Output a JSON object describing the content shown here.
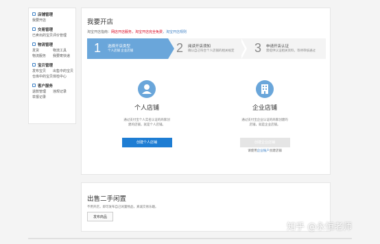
{
  "sidebar": {
    "groups": [
      {
        "title": "店铺管理",
        "rows": [
          [
            "我要开店",
            ""
          ]
        ]
      },
      {
        "title": "交易管理",
        "rows": [
          [
            "已卖出的宝贝",
            "评价管理"
          ]
        ]
      },
      {
        "title": "物流管理",
        "rows": [
          [
            "发货",
            "物流工具"
          ],
          [
            "物流服务",
            "我要寄快递"
          ]
        ]
      },
      {
        "title": "宝贝管理",
        "rows": [
          [
            "发布宝贝",
            "出售中的宝贝"
          ],
          [
            "仓库中的宝贝",
            "体检中心"
          ]
        ]
      },
      {
        "title": "客户服务",
        "rows": [
          [
            "退款管理",
            "违规记录"
          ],
          [
            "举报记录",
            ""
          ]
        ]
      }
    ]
  },
  "main": {
    "title": "我要开店",
    "tip_prefix": "淘宝开店指南：",
    "tip_red": "网店开店服务，淘宝开店完全免费",
    "tip_blue": "，淘宝开店规则",
    "steps": [
      {
        "num": "1",
        "title": "选择开店类型",
        "desc": "个人店铺 企业店铺"
      },
      {
        "num": "2",
        "title": "阅读开店须知",
        "desc": "确认自己符合个人店铺的相关规定"
      },
      {
        "num": "3",
        "title": "申请开店认证",
        "desc": "需提供认证相关资料，等待审核通过"
      }
    ],
    "personal": {
      "name": "个人店铺",
      "desc1": "通过支付宝个人实名认证的商家创",
      "desc2": "建的店铺，就是个人店铺。",
      "button": "创建个人店铺"
    },
    "enterprise": {
      "name": "企业店铺",
      "desc1": "通过支付宝企业认证的商家创建的",
      "desc2": "店铺，就是企业店铺。",
      "button": "创建企业店铺",
      "link_prefix": "请使用",
      "link": "企业账户",
      "link_suffix": "创建店铺"
    }
  },
  "second": {
    "title": "出售二手闲置",
    "desc": "不用开店，即可发布自己闲置物品，真诚交易乐趣。",
    "button": "发布商品"
  },
  "watermark": "知乎 @永恒老师",
  "colors": {
    "accent": "#1e7dd3",
    "step_active": "#6aa6da",
    "red": "#d9001b"
  }
}
